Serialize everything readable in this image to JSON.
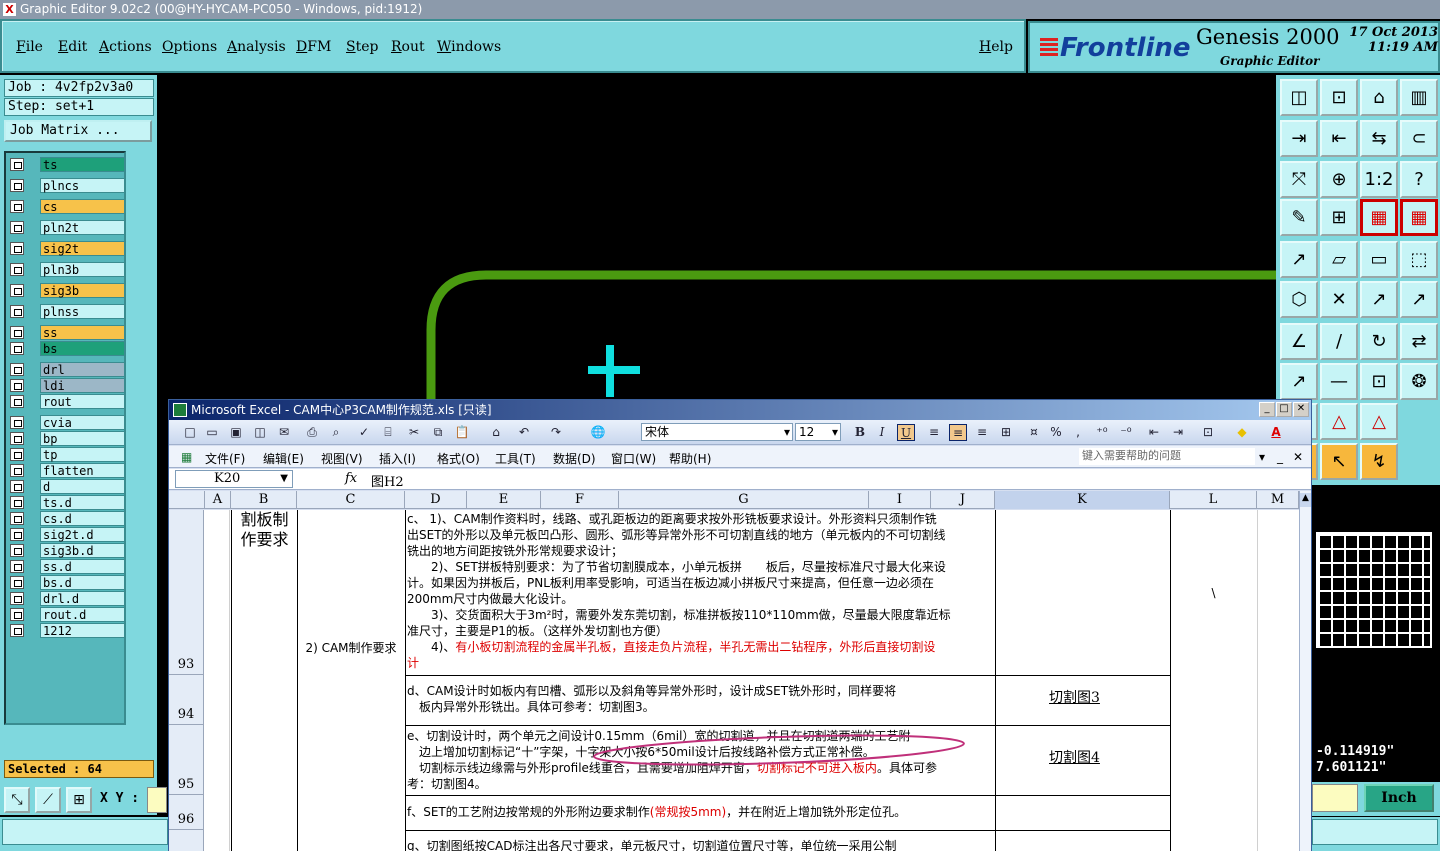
{
  "genesis": {
    "window_title": "Graphic Editor 9.02c2 (00@HY-HYCAM-PC050 - Windows, pid:1912)",
    "menu": [
      "File",
      "Edit",
      "Actions",
      "Options",
      "Analysis",
      "DFM",
      "Step",
      "Rout",
      "Windows"
    ],
    "help": "Help",
    "brand": {
      "logo": "Frontline",
      "product": "Genesis 2000",
      "subtitle": "Graphic Editor",
      "date": "17 Oct 2013",
      "time": "11:19 AM"
    },
    "job": "Job : 4v2fp2v3a0",
    "step": "Step: set+1",
    "job_matrix": "Job Matrix ...",
    "layers": [
      {
        "name": "ts",
        "color": "#1ea07a"
      },
      {
        "name": "plncs",
        "color": "#c6f4f6"
      },
      {
        "name": "cs",
        "color": "#f7c24a"
      },
      {
        "name": "pln2t",
        "color": "#c6f4f6"
      },
      {
        "name": "sig2t",
        "color": "#f7c24a"
      },
      {
        "name": "pln3b",
        "color": "#c6f4f6"
      },
      {
        "name": "sig3b",
        "color": "#f7c24a"
      },
      {
        "name": "plnss",
        "color": "#c6f4f6"
      },
      {
        "name": "ss",
        "color": "#f7c24a"
      },
      {
        "name": "bs",
        "color": "#1ea07a"
      },
      {
        "name": "drl",
        "color": "#9cb7c7"
      },
      {
        "name": "ldi",
        "color": "#9cb7c7"
      },
      {
        "name": "rout",
        "color": "#c6f4f6"
      },
      {
        "name": "cvia",
        "color": "#c6f4f6"
      },
      {
        "name": "bp",
        "color": "#c6f4f6"
      },
      {
        "name": "tp",
        "color": "#c6f4f6"
      },
      {
        "name": "flatten",
        "color": "#c6f4f6"
      },
      {
        "name": "d",
        "color": "#c6f4f6"
      },
      {
        "name": "ts.d",
        "color": "#c6f4f6"
      },
      {
        "name": "cs.d",
        "color": "#c6f4f6"
      },
      {
        "name": "sig2t.d",
        "color": "#c6f4f6"
      },
      {
        "name": "sig3b.d",
        "color": "#c6f4f6"
      },
      {
        "name": "ss.d",
        "color": "#c6f4f6"
      },
      {
        "name": "bs.d",
        "color": "#c6f4f6"
      },
      {
        "name": "drl.d",
        "color": "#c6f4f6"
      },
      {
        "name": "rout.d",
        "color": "#c6f4f6"
      },
      {
        "name": "1212",
        "color": "#c6f4f6"
      }
    ],
    "selected": "Selected : 64",
    "xy_label": "X Y :",
    "coords": {
      "x": "-0.114919\"",
      "y": "7.601121\""
    },
    "units": "Inch"
  },
  "excel": {
    "title": "Microsoft Excel - CAM中心P3CAM制作规范.xls [只读]",
    "font_name": "宋体",
    "font_size": "12",
    "menu": [
      "文件(F)",
      "编辑(E)",
      "视图(V)",
      "插入(I)",
      "格式(O)",
      "工具(T)",
      "数据(D)",
      "窗口(W)",
      "帮助(H)"
    ],
    "help_placeholder": "键入需要帮助的问题",
    "cell_ref": "K20",
    "fx": "fx",
    "formula": "图H2",
    "columns": [
      "A",
      "B",
      "C",
      "D",
      "E",
      "F",
      "G",
      "I",
      "J",
      "K",
      "L",
      "M"
    ],
    "rows": [
      "93",
      "94",
      "95",
      "96"
    ],
    "b_text": "割板制作要求",
    "c_text": "2) CAM制作要求",
    "r93_lines": [
      "c、 1)、CAM制作资料时，线路、或孔距板边的距离要求按外形铣板要求设计。外形资料只须制作铣",
      "出SET的外形以及单元板凹凸形、圆形、弧形等异常外形不可切割直线的地方（单元板内的不可切割线",
      "铣出的地方间距按铣外形常规要求设计；",
      "　　2)、SET拼板特别要求：为了节省切割膜成本，小单元板拼　　板后，尽量按标准尺寸最大化来设",
      "计。如果因为拼板后，PNL板利用率受影响，可适当在板边减小拼板尺寸来提高，但任意一边必须在",
      "200mm尺寸内做最大化设计。",
      "　　3)、交货面积大于3m²时，需要外发东莞切割，标准拼板按110*110mm做，尽量最大限度靠近标",
      "准尺寸，主要是P1的板。（这样外发切割也方便）"
    ],
    "r93_red_prefix": "　　4)、",
    "r93_red_1": "有小板切割流程的金属半孔板，直接走负片流程，半孔无需出二钻程序，外形后直接切割设",
    "r93_red_2": "计",
    "r93_k": "\\",
    "r94_lines": [
      "d、CAM设计时如板内有凹槽、弧形以及斜角等异常外形时，设计成SET铣外形时，同样要将",
      "　板内异常外形铣出。具体可参考：切割图3。"
    ],
    "r94_k": "切割图3",
    "r95_line1": "e、切割设计时，两个单元之间设计0.15mm（6mil）宽的切割道，并且在切割道两端的工艺附",
    "r95_line2": "　边上增加切割标记“十”字架，十字架大小按6*50mil设计后按线路补偿方式正常补偿。",
    "r95_line3a": "　切割标示线边缘需与外形profile线重合，且需要增加阻焊开窗，",
    "r95_line3b": "切割标记不可进入板内",
    "r95_line3c": "。具体可参",
    "r95_line4": "考：切割图4。",
    "r95_k": "切割图4",
    "r96_a": "f、SET的工艺附边按常规的外形附边要求制作",
    "r96_b": "(常规按5mm)",
    "r96_c": "，并在附近上增加铣外形定位孔。",
    "r97": "g、切割图纸按CAD标注出各尺寸要求，单元板尺寸，切割道位置尺寸等，单位统一采用公制"
  }
}
